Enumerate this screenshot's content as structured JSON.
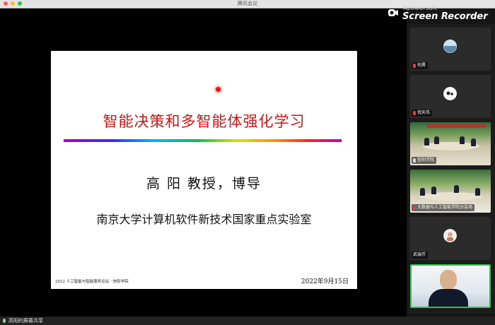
{
  "window": {
    "title": "腾讯会议"
  },
  "recorder": {
    "line1": "Apowersoft",
    "line2": "Screen Recorder"
  },
  "slide": {
    "title": "智能决策和多智能体强化学习",
    "speaker": "高 阳 教授，博导",
    "lab": "南京大学计算机软件新技术国家重点实验室",
    "footer": "2022 人工智能与智能服务论坛 · 信阳学院",
    "date": "2022年9月15日"
  },
  "participants": [
    {
      "name": "何勇",
      "type": "avatar",
      "mic": "muted"
    },
    {
      "name": "倪天伟",
      "type": "avatar",
      "mic": "muted"
    },
    {
      "name": "信阳学院",
      "type": "video",
      "mic": "on"
    },
    {
      "name": "大数据与人工智能学院分会场",
      "type": "video",
      "mic": "muted"
    },
    {
      "name": "武瑞芬",
      "type": "avatar",
      "mic": "off"
    },
    {
      "name": "",
      "type": "video",
      "mic": "none"
    }
  ],
  "bottombar": {
    "label": "高阳的屏幕共享"
  },
  "colors": {
    "accent_green": "#35c24a",
    "title_red": "#d41414"
  }
}
